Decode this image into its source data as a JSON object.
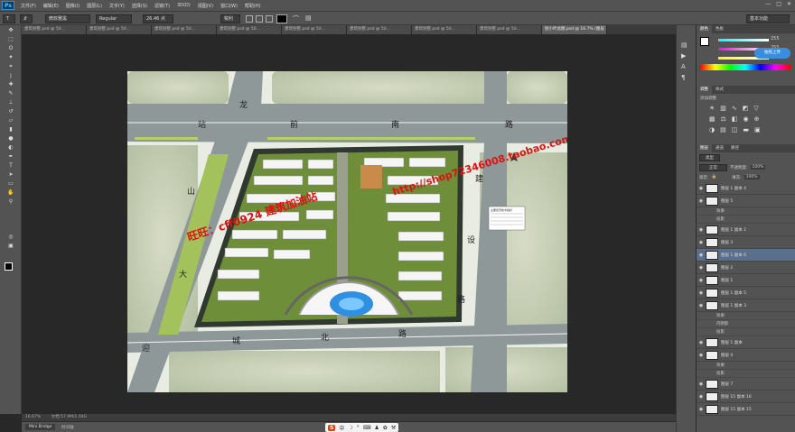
{
  "app": {
    "logo": "Ps"
  },
  "menu": [
    "文件(F)",
    "编辑(E)",
    "图像(I)",
    "图层(L)",
    "文字(Y)",
    "选择(S)",
    "滤镜(T)",
    "3D(D)",
    "视图(V)",
    "窗口(W)",
    "帮助(H)"
  ],
  "window_controls": {
    "minimize": "—",
    "maximize": "□",
    "close": "✕"
  },
  "options": {
    "font_family": "微软雅黑",
    "font_style": "Regular",
    "font_size": "26.46 点",
    "aa_mode": "锐利",
    "workspace": "基本功能"
  },
  "tabs": [
    "建筑别墅.psd @ 50...",
    "建筑别墅.psd @ 50...",
    "建筑别墅.psd @ 50...",
    "建筑别墅.psd @ 50...",
    "建筑别墅.psd @ 50...",
    "建筑别墅.psd @ 50...",
    "建筑别墅.psd @ 50...",
    "建筑别墅.psd @ 50...",
    "别小叶总图.psd @ 16.7% (图层 1 副本 6, RGB/8) *"
  ],
  "status": {
    "zoom": "16.67%",
    "doc": "文档:57.9M/1.04G"
  },
  "bottom_tabs": [
    "Mini Bridge",
    "时间轴"
  ],
  "ime": {
    "brand": "S",
    "items": [
      "中",
      "☽",
      "°",
      "⌨",
      "♟",
      "✿",
      "⚒"
    ]
  },
  "color_panel": {
    "tabs": [
      "颜色",
      "色板"
    ],
    "r": "255",
    "g": "255",
    "b": "255",
    "upload_tip": "拍照上传"
  },
  "adjust_panel": {
    "tabs": [
      "调整",
      "样式"
    ],
    "title": "添加调整"
  },
  "layers_panel": {
    "tabs": [
      "图层",
      "通道",
      "路径"
    ],
    "kind": "类型",
    "blend": "正常",
    "opacity_label": "不透明度:",
    "opacity": "100%",
    "lock_label": "锁定:",
    "fill_label": "填充:",
    "fill": "100%",
    "rows": [
      {
        "name": "图层 1 副本 4",
        "type": "layer"
      },
      {
        "name": "图层 5",
        "type": "layer"
      },
      {
        "name": "效果",
        "type": "sub"
      },
      {
        "name": "投影",
        "type": "sub"
      },
      {
        "name": "图层 1 副本 2",
        "type": "layer"
      },
      {
        "name": "图层 3",
        "type": "layer"
      },
      {
        "name": "图层 1 副本 6",
        "type": "layer",
        "selected": true
      },
      {
        "name": "图层 2",
        "type": "layer"
      },
      {
        "name": "图层 1",
        "type": "layer"
      },
      {
        "name": "图层 1 副本 5",
        "type": "layer"
      },
      {
        "name": "图层 1 副本 3",
        "type": "layer"
      },
      {
        "name": "效果",
        "type": "sub"
      },
      {
        "name": "内阴影",
        "type": "sub"
      },
      {
        "name": "投影",
        "type": "sub"
      },
      {
        "name": "图层 1 副本",
        "type": "layer"
      },
      {
        "name": "图层 4",
        "type": "layer"
      },
      {
        "name": "效果",
        "type": "sub"
      },
      {
        "name": "投影",
        "type": "sub"
      },
      {
        "name": "图层 7",
        "type": "layer"
      },
      {
        "name": "图层 15 副本 16",
        "type": "layer"
      },
      {
        "name": "图层 15 副本 15",
        "type": "layer"
      }
    ]
  },
  "map": {
    "roads": {
      "north": [
        "站",
        "前",
        "南",
        "路"
      ],
      "east": [
        "建",
        "设",
        "路"
      ],
      "south": [
        "城",
        "北",
        "路"
      ],
      "west": [
        "大",
        "山",
        "龙",
        "迎"
      ]
    },
    "watermark1": "旺旺：cff0924 建筑加油站",
    "watermark2": "http://shop72346008.taobao.com",
    "legend_title": "主要经济技术指标"
  },
  "colors": {
    "chrome": "#535353",
    "canvas": "#282828",
    "grass": "#c8d4a8",
    "road": "#8f9899",
    "accent_red": "#e01010",
    "water": "#2f8fe0"
  }
}
